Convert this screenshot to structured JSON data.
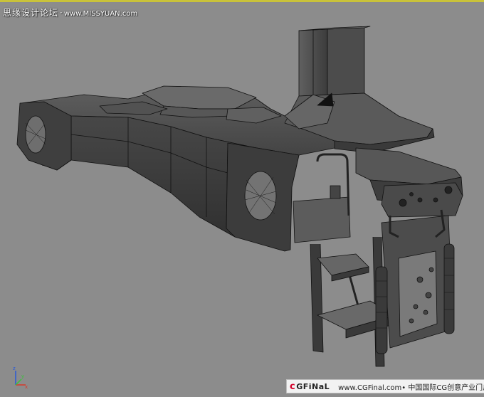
{
  "watermark": {
    "title": "思缘设计论坛",
    "url": "www.MISSYUAN.com"
  },
  "brand_bar": {
    "logo_c": "c",
    "logo_rest": "GFiNaL",
    "text": "www.CGFinal.com• 中国国际CG创意产业门户"
  },
  "viewport": {
    "background": "#8c8c8c",
    "border_color": "#c9c23a"
  },
  "gizmo": {
    "z_label": "z",
    "x_label": "x",
    "y_label": "y",
    "x_color": "#d63a2a",
    "y_color": "#3ac23a",
    "z_color": "#2a5ad6"
  }
}
